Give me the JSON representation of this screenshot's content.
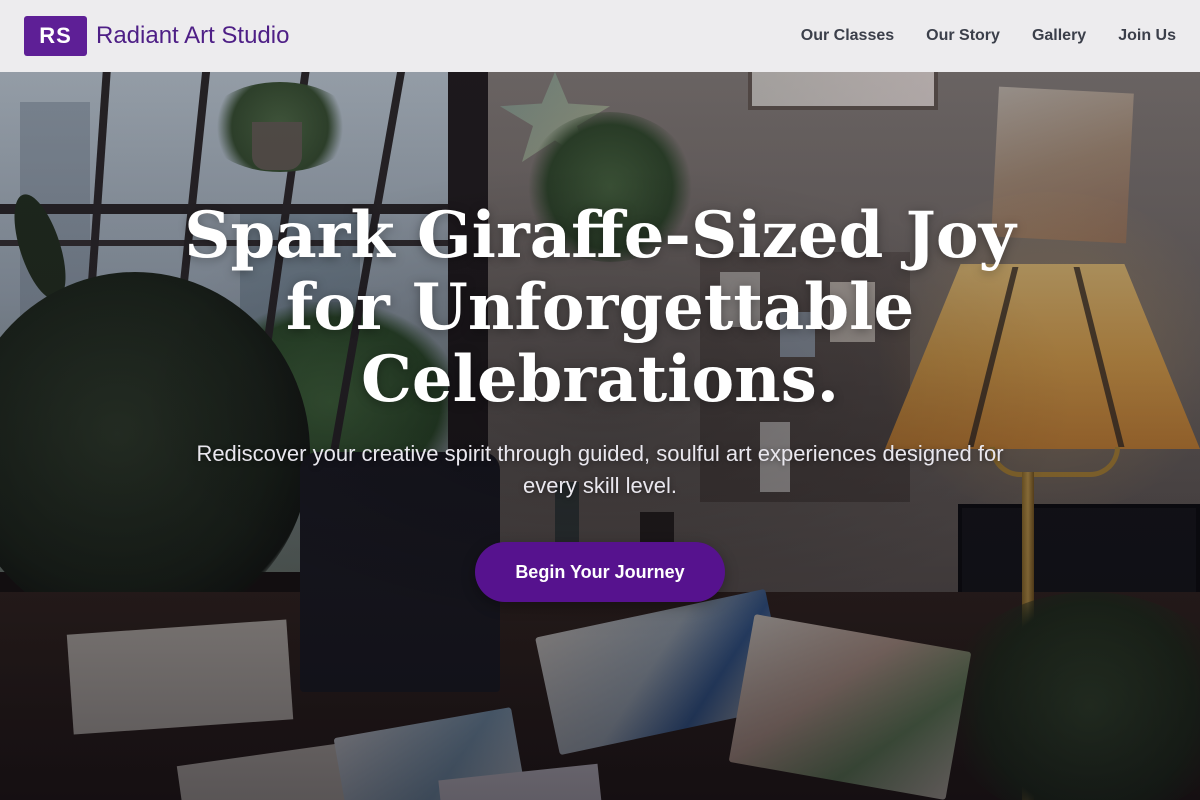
{
  "header": {
    "logo_mark": "RS",
    "brand_name": "Radiant Art Studio",
    "nav": [
      {
        "label": "Our Classes"
      },
      {
        "label": "Our Story"
      },
      {
        "label": "Gallery"
      },
      {
        "label": "Join Us"
      }
    ]
  },
  "hero": {
    "title": "Spark Giraffe-Sized Joy for Unforgettable Celebrations.",
    "subtitle": "Rediscover your creative spirit through guided, soulful art experiences designed for every skill level.",
    "cta_label": "Begin Your Journey",
    "background": "art studio workspace with plants, lamp and sketchbooks"
  },
  "colors": {
    "brand": "#5e1f96",
    "cta": "#56128e",
    "header_bg": "#f6f6f8",
    "nav_text": "#3b3f4a",
    "hero_text": "#ffffff"
  }
}
